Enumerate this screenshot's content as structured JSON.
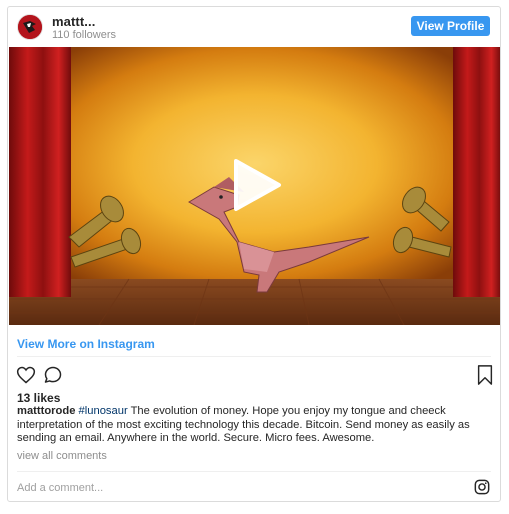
{
  "header": {
    "username": "mattt...",
    "followers": "110 followers",
    "view_profile_label": "View Profile"
  },
  "media": {
    "type": "video",
    "play_icon": "play-icon"
  },
  "view_more_label": "View More on Instagram",
  "actions": {
    "like_icon": "heart-icon",
    "comment_icon": "comment-icon",
    "save_icon": "bookmark-icon"
  },
  "likes": "13 likes",
  "caption": {
    "username": "matttorode",
    "hashtag": "#lunosaur",
    "text": " The evolution of money. Hope you enjoy my tongue and cheeck interpretation of the most exciting technology this decade. Bitcoin. Send money as easily as sending an email. Anywhere in the world. Secure. Micro fees. Awesome."
  },
  "view_comments_label": "view all comments",
  "comment_input": {
    "placeholder": "Add a comment..."
  },
  "colors": {
    "accent": "#3897f0",
    "text": "#262626",
    "muted": "#8e8e8e",
    "border": "#dbdbdb"
  }
}
